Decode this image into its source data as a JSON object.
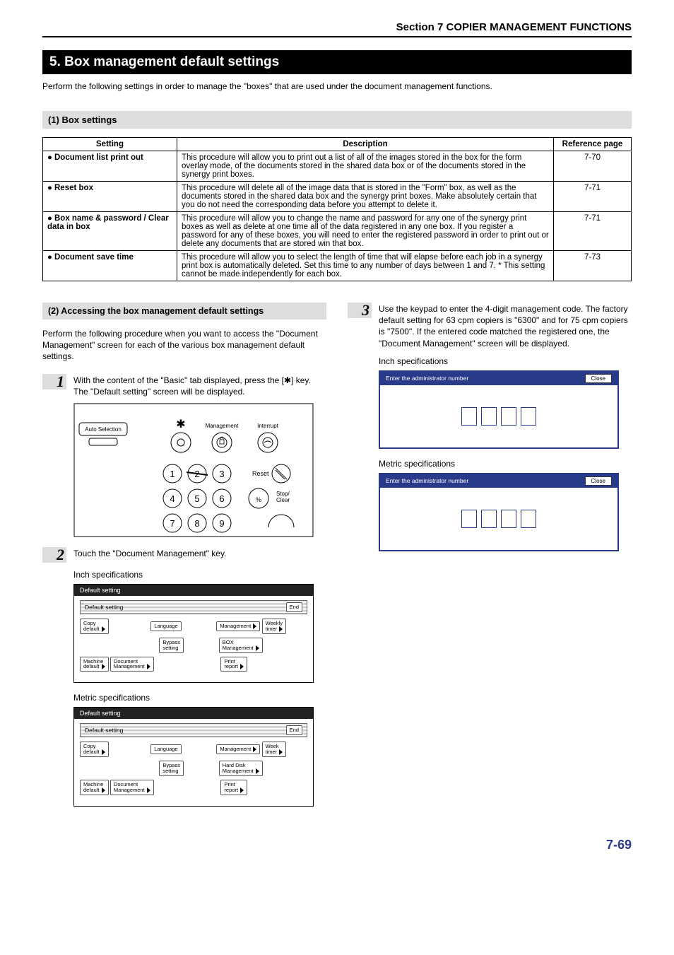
{
  "header": "Section 7  COPIER MANAGEMENT FUNCTIONS",
  "title": "5. Box management default settings",
  "intro": "Perform the following settings in order to manage the \"boxes\" that are used under the document management functions.",
  "sub1": "(1) Box settings",
  "table": {
    "h1": "Setting",
    "h2": "Description",
    "h3": "Reference page",
    "rows": [
      {
        "s": "Document list print out",
        "d": "This procedure will allow you to print out a list of all of the images stored in the box for the form overlay mode, of the documents stored in the shared data box or of the documents stored in the synergy print boxes.",
        "r": "7-70"
      },
      {
        "s": "Reset box",
        "d": "This procedure will delete all of the image data that is stored in the \"Form\" box, as well as the documents stored in the shared data box and the synergy print boxes. Make absolutely certain that you do not need the corresponding data before you attempt to delete it.",
        "r": "7-71"
      },
      {
        "s": "Box name & password / Clear data in box",
        "d": "This procedure will allow you to change the name and password for any one of the synergy print boxes as well as delete at one time all of the data registered in any one box. If you register a password for any of these boxes, you will need to enter the registered password in order to print out or delete any documents that are stored win that box.",
        "r": "7-71"
      },
      {
        "s": "Document save time",
        "d": "This procedure will allow you to select the length of time that will elapse before each job in a synergy print box is automatically deleted. Set this time to any number of days between 1 and 7. * This setting cannot be made independently for each box.",
        "r": "7-73"
      }
    ]
  },
  "sub2": "(2) Accessing the box management default settings",
  "access_para": "Perform the following procedure when you want to access the \"Document Management\" screen for each of the various box management default settings.",
  "step1": "With the content of the \"Basic\" tab displayed, press the [✱] key. The \"Default setting\" screen will be displayed.",
  "step2": "Touch the \"Document Management\" key.",
  "step3": "Use the keypad to enter the 4-digit management code. The factory default setting for 63 cpm copiers is \"6300\" and for 75 cpm copiers is \"7500\".  If the entered code matched the registered one, the \"Document Management\" screen will be displayed.",
  "inch": "Inch specifications",
  "metric": "Metric specifications",
  "panel": {
    "auto": "Auto Selection",
    "mgmt": "Management",
    "intr": "Interrupt",
    "reset": "Reset",
    "stop": "Stop/\nClear"
  },
  "screenA": {
    "title": "Default setting",
    "bar": "Default setting",
    "end": "End",
    "copy": "Copy\ndefault",
    "machine": "Machine\ndefault",
    "doc": "Document\nManagement",
    "lang": "Language",
    "bypass": "Bypass\nsetting",
    "mgmt": "Management",
    "box": "BOX\nManagement",
    "print": "Print\nreport",
    "weekly": "Weekly\ntimer"
  },
  "screenB": {
    "title": "Default setting",
    "bar": "Default setting",
    "end": "End",
    "copy": "Copy\ndefault",
    "machine": "Machine\ndefault",
    "doc": "Document\nManagement",
    "lang": "Language",
    "bypass": "Bypass\nsetting",
    "mgmt": "Management",
    "hd": "Hard Disk\nManagement",
    "print": "Print\nreport",
    "week": "Week\ntimer"
  },
  "admin": {
    "prompt": "Enter the administrator number",
    "close": "Close"
  },
  "page": "7-69"
}
